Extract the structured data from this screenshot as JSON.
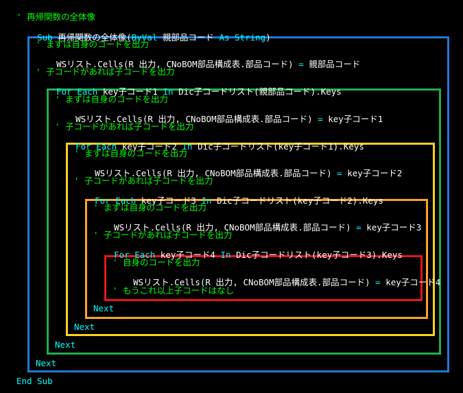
{
  "colors": {
    "background": "#000000",
    "comment": "#00ff00",
    "keyword": "#00ffff",
    "text": "#ffffff",
    "box_blue": "#1e7ad6",
    "box_green": "#20b04a",
    "box_yellow": "#ffd21a",
    "box_orange": "#ffa424",
    "box_red": "#e8141c"
  },
  "header": {
    "title_comment": "' 再帰関数の全体像",
    "sub_kw": "Sub",
    "sub_name": " 再帰関数の全体像(",
    "byval_kw": "ByVal",
    "param": " 親部品コード ",
    "as_string_kw": "As String",
    "close_paren": ")"
  },
  "level1": {
    "comment_output": "' まずは自身のコードを出力",
    "output_prefix": "WSリスト.Cells(R 出力, CNoBOM部品構成表.部品コード)",
    "output_eq": " = ",
    "output_value": "親部品コード",
    "comment_children": "' 子コードがあれば子コードを出力",
    "for_kw": "For Each",
    "for_var": " key子コード1 ",
    "in_kw": "In",
    "for_expr": " Dic子コードリスト(親部品コード).Keys",
    "next_kw": "Next"
  },
  "level2": {
    "comment_output": "' まずは自身のコードを出力",
    "output_prefix": "WSリスト.Cells(R 出力, CNoBOM部品構成表.部品コード)",
    "output_eq": " = ",
    "output_value": "key子コード1",
    "comment_children": "' 子コードがあれば子コードを出力",
    "for_kw": "For Each",
    "for_var": " key子コード2 ",
    "in_kw": "In",
    "for_expr": " Dic子コードリスト(key子コード1).Keys",
    "next_kw": "Next"
  },
  "level3": {
    "comment_output": "' まずは自身のコードを出力",
    "output_prefix": "WSリスト.Cells(R 出力, CNoBOM部品構成表.部品コード)",
    "output_eq": " = ",
    "output_value": "key子コード2",
    "comment_children": "' 子コードがあれば子コードを出力",
    "for_kw": "For Each",
    "for_var": " key子コード3 ",
    "in_kw": "In",
    "for_expr": " Dic子コードリスト(key子コード2).Keys",
    "next_kw": "Next"
  },
  "level4": {
    "comment_output": "' まずは自身のコードを出力",
    "output_prefix": "WSリスト.Cells(R 出力, CNoBOM部品構成表.部品コード)",
    "output_eq": " = ",
    "output_value": "key子コード3",
    "comment_children": "' 子コードがあれば子コードを出力",
    "for_kw": "For Each",
    "for_var": " key子コード4 ",
    "in_kw": "In",
    "for_expr": " Dic子コードリスト(key子コード3).Keys",
    "next_kw": "Next"
  },
  "level5": {
    "comment_output": "' 自身のコードを出力",
    "output_prefix": "WSリスト.Cells(R 出力, CNoBOM部品構成表.部品コード)",
    "output_eq": " = ",
    "output_value": "key子コード4",
    "comment_end": "' もうこれ以上子コードはなし"
  },
  "footer": {
    "end_sub_kw": "End Sub"
  }
}
